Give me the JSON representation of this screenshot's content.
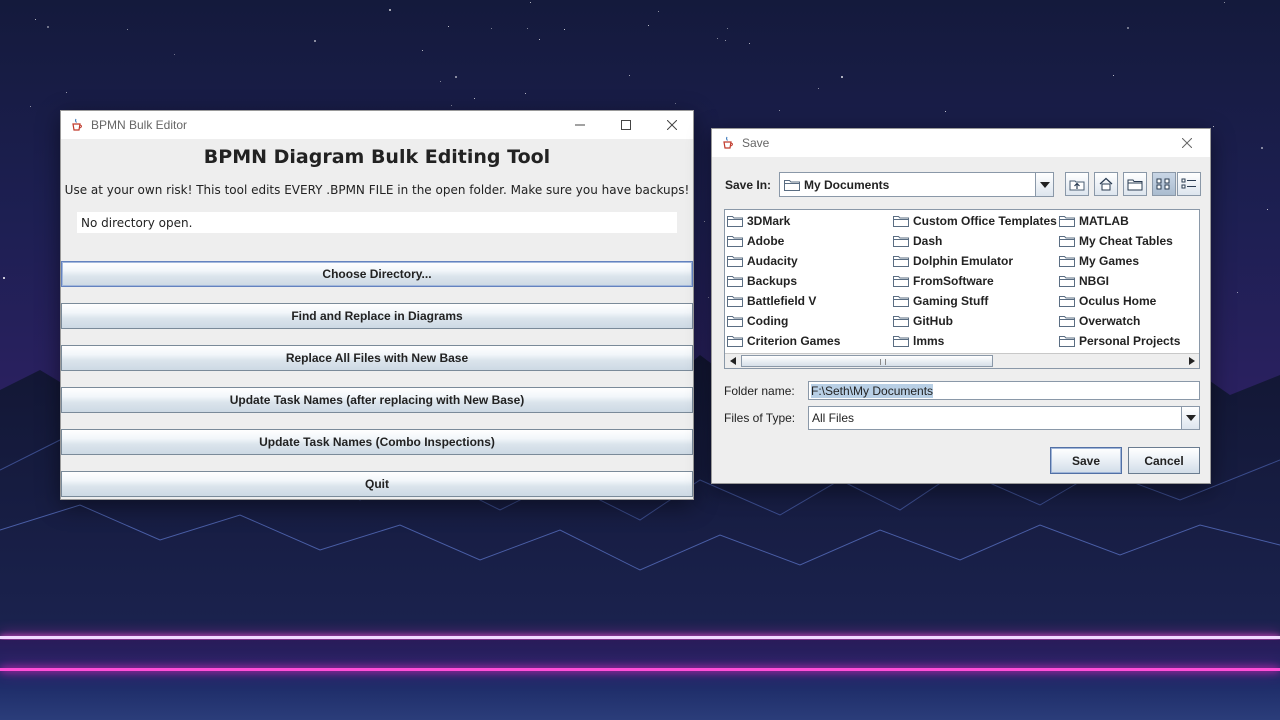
{
  "bpmn_window": {
    "title": "BPMN Bulk Editor",
    "heading": "BPMN Diagram Bulk Editing Tool",
    "warning": "Use at your own risk! This tool edits EVERY .BPMN FILE in the open folder. Make sure you have backups!",
    "directory_status": "No directory open.",
    "buttons": [
      "Choose Directory...",
      "Find and Replace in Diagrams",
      "Replace All Files with New Base",
      "Update Task Names (after replacing with New Base)",
      "Update Task Names (Combo Inspections)",
      "Quit"
    ]
  },
  "save_dialog": {
    "title": "Save",
    "save_in_label": "Save In:",
    "save_in_value": "My Documents",
    "files": [
      [
        "3DMark",
        "Adobe",
        "Audacity",
        "Backups",
        "Battlefield V",
        "Coding",
        "Criterion Games"
      ],
      [
        "Custom Office Templates",
        "Dash",
        "Dolphin Emulator",
        "FromSoftware",
        "Gaming Stuff",
        "GitHub",
        "lmms"
      ],
      [
        "MATLAB",
        "My Cheat Tables",
        "My Games",
        "NBGI",
        "Oculus Home",
        "Overwatch",
        "Personal Projects"
      ]
    ],
    "folder_name_label": "Folder name:",
    "folder_name_value": "F:\\Seth\\My Documents",
    "files_of_type_label": "Files of Type:",
    "files_of_type_value": "All Files",
    "save_button": "Save",
    "cancel_button": "Cancel",
    "toolbar_icons": [
      "up-one-level-icon",
      "home-icon",
      "new-folder-icon",
      "list-view-icon",
      "details-view-icon"
    ]
  }
}
